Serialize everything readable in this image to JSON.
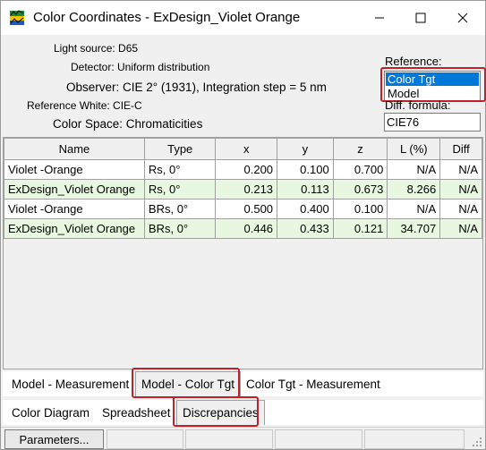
{
  "window": {
    "title": "Color Coordinates - ExDesign_Violet Orange",
    "controls": {
      "minimize": "minimize",
      "maximize": "maximize",
      "close": "close"
    }
  },
  "info": {
    "light_source": "Light source: D65",
    "detector": "Detector: Uniform distribution",
    "observer": "Observer: CIE 2° (1931),   Integration step = 5 nm",
    "reference_white": "Reference White: CIE-C",
    "color_space": "Color Space: Chromaticities"
  },
  "reference": {
    "label": "Reference:",
    "options": [
      "Color Tgt",
      "Model"
    ],
    "selected": "Color Tgt"
  },
  "diff_formula": {
    "label": "Diff. formula:",
    "value": "CIE76"
  },
  "table": {
    "columns": [
      "Name",
      "Type",
      "x",
      "y",
      "z",
      "L (%)",
      "Diff"
    ],
    "rows": [
      [
        "Violet -Orange",
        "Rs, 0°",
        "0.200",
        "0.100",
        "0.700",
        "N/A",
        "N/A"
      ],
      [
        "ExDesign_Violet Orange",
        "Rs, 0°",
        "0.213",
        "0.113",
        "0.673",
        "8.266",
        "N/A"
      ],
      [
        "Violet -Orange",
        "BRs, 0°",
        "0.500",
        "0.400",
        "0.100",
        "N/A",
        "N/A"
      ],
      [
        "ExDesign_Violet Orange",
        "BRs, 0°",
        "0.446",
        "0.433",
        "0.121",
        "34.707",
        "N/A"
      ]
    ]
  },
  "compare_tabs": [
    "Model - Measurement",
    "Model - Color Tgt",
    "Color Tgt - Measurement"
  ],
  "compare_tab_selected": "Model - Color Tgt",
  "view_tabs": [
    "Color Diagram",
    "Spreadsheet",
    "Discrepancies"
  ],
  "view_tab_selected": "Discrepancies",
  "statusbar": {
    "parameters_button": "Parameters..."
  },
  "colors": {
    "highlight": "#c0202a",
    "selection": "#0078d7",
    "green_row": "#e8f8e0"
  }
}
